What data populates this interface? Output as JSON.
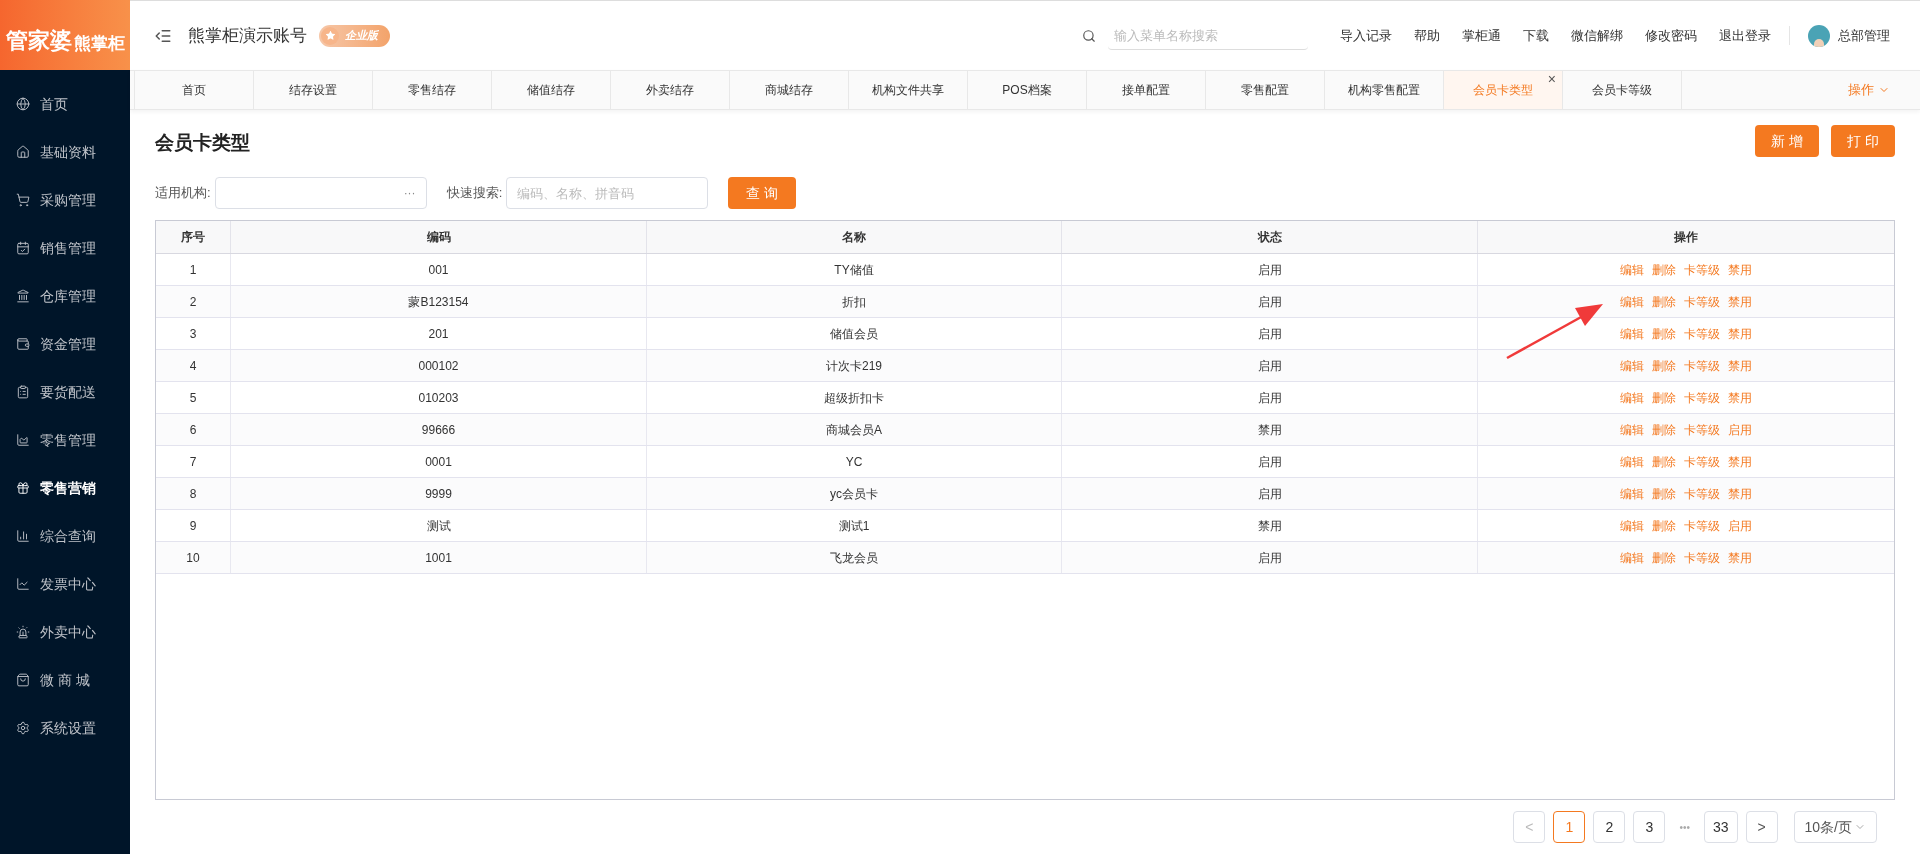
{
  "logo": {
    "brand": "管家婆",
    "product": "熊掌柜"
  },
  "sidebar": {
    "items": [
      {
        "label": "首页",
        "selected": false
      },
      {
        "label": "基础资料",
        "selected": false
      },
      {
        "label": "采购管理",
        "selected": false
      },
      {
        "label": "销售管理",
        "selected": false
      },
      {
        "label": "仓库管理",
        "selected": false
      },
      {
        "label": "资金管理",
        "selected": false
      },
      {
        "label": "要货配送",
        "selected": false
      },
      {
        "label": "零售管理",
        "selected": false
      },
      {
        "label": "零售营销",
        "selected": true
      },
      {
        "label": "综合查询",
        "selected": false
      },
      {
        "label": "发票中心",
        "selected": false
      },
      {
        "label": "外卖中心",
        "selected": false
      },
      {
        "label": "微 商 城",
        "selected": false
      },
      {
        "label": "系统设置",
        "selected": false
      }
    ]
  },
  "header": {
    "account": "熊掌柜演示账号",
    "edition_badge": "企业版",
    "search": {
      "placeholder": "输入菜单名称搜索"
    },
    "links": [
      "导入记录",
      "帮助",
      "掌柜通",
      "下载",
      "微信解绑",
      "修改密码",
      "退出登录"
    ],
    "user": "总部管理"
  },
  "tabs": [
    {
      "label": "首页",
      "selected": false
    },
    {
      "label": "结存设置",
      "selected": false
    },
    {
      "label": "零售结存",
      "selected": false
    },
    {
      "label": "储值结存",
      "selected": false
    },
    {
      "label": "外卖结存",
      "selected": false
    },
    {
      "label": "商城结存",
      "selected": false
    },
    {
      "label": "机构文件共享",
      "selected": false
    },
    {
      "label": "POS档案",
      "selected": false
    },
    {
      "label": "接单配置",
      "selected": false
    },
    {
      "label": "零售配置",
      "selected": false
    },
    {
      "label": "机构零售配置",
      "selected": false
    },
    {
      "label": "会员卡类型",
      "selected": true,
      "close": "×"
    },
    {
      "label": "会员卡等级",
      "selected": false
    }
  ],
  "tabs_menu": "操作",
  "page": {
    "title": "会员卡类型",
    "buttons": [
      "新 增",
      "打 印"
    ]
  },
  "filters": {
    "org_label": "适用机构:",
    "org_picker": "···",
    "search_label": "快速搜索:",
    "search": {
      "placeholder": "编码、名称、拼音码"
    },
    "query_button": "查 询"
  },
  "table": {
    "columns": [
      "序号",
      "编码",
      "名称",
      "状态",
      "操作"
    ],
    "rows": [
      {
        "cells": [
          "1",
          "001",
          "TY储值",
          "启用"
        ],
        "actions": [
          "编辑",
          "删除",
          "卡等级",
          "禁用"
        ]
      },
      {
        "cells": [
          "2",
          "蒙B123154",
          "折扣",
          "启用"
        ],
        "actions": [
          "编辑",
          "删除",
          "卡等级",
          "禁用"
        ]
      },
      {
        "cells": [
          "3",
          "201",
          "储值会员",
          "启用"
        ],
        "actions": [
          "编辑",
          "删除",
          "卡等级",
          "禁用"
        ]
      },
      {
        "cells": [
          "4",
          "000102",
          "计次卡219",
          "启用"
        ],
        "actions": [
          "编辑",
          "删除",
          "卡等级",
          "禁用"
        ]
      },
      {
        "cells": [
          "5",
          "010203",
          "超级折扣卡",
          "启用"
        ],
        "actions": [
          "编辑",
          "删除",
          "卡等级",
          "禁用"
        ]
      },
      {
        "cells": [
          "6",
          "99666",
          "商城会员A",
          "禁用"
        ],
        "actions": [
          "编辑",
          "删除",
          "卡等级",
          "启用"
        ]
      },
      {
        "cells": [
          "7",
          "0001",
          "YC",
          "启用"
        ],
        "actions": [
          "编辑",
          "删除",
          "卡等级",
          "禁用"
        ]
      },
      {
        "cells": [
          "8",
          "9999",
          "yc会员卡",
          "启用"
        ],
        "actions": [
          "编辑",
          "删除",
          "卡等级",
          "禁用"
        ]
      },
      {
        "cells": [
          "9",
          "测试",
          "测试1",
          "禁用"
        ],
        "actions": [
          "编辑",
          "删除",
          "卡等级",
          "启用"
        ]
      },
      {
        "cells": [
          "10",
          "1001",
          "飞龙会员",
          "启用"
        ],
        "actions": [
          "编辑",
          "删除",
          "卡等级",
          "禁用"
        ]
      }
    ]
  },
  "pagination": {
    "prev": "<",
    "pages": [
      {
        "label": "1",
        "selected": true
      },
      {
        "label": "2",
        "selected": false
      },
      {
        "label": "3",
        "selected": false
      }
    ],
    "ellipsis": "•••",
    "last": {
      "label": "33",
      "selected": false
    },
    "next": ">",
    "page_size": "10条/页"
  }
}
